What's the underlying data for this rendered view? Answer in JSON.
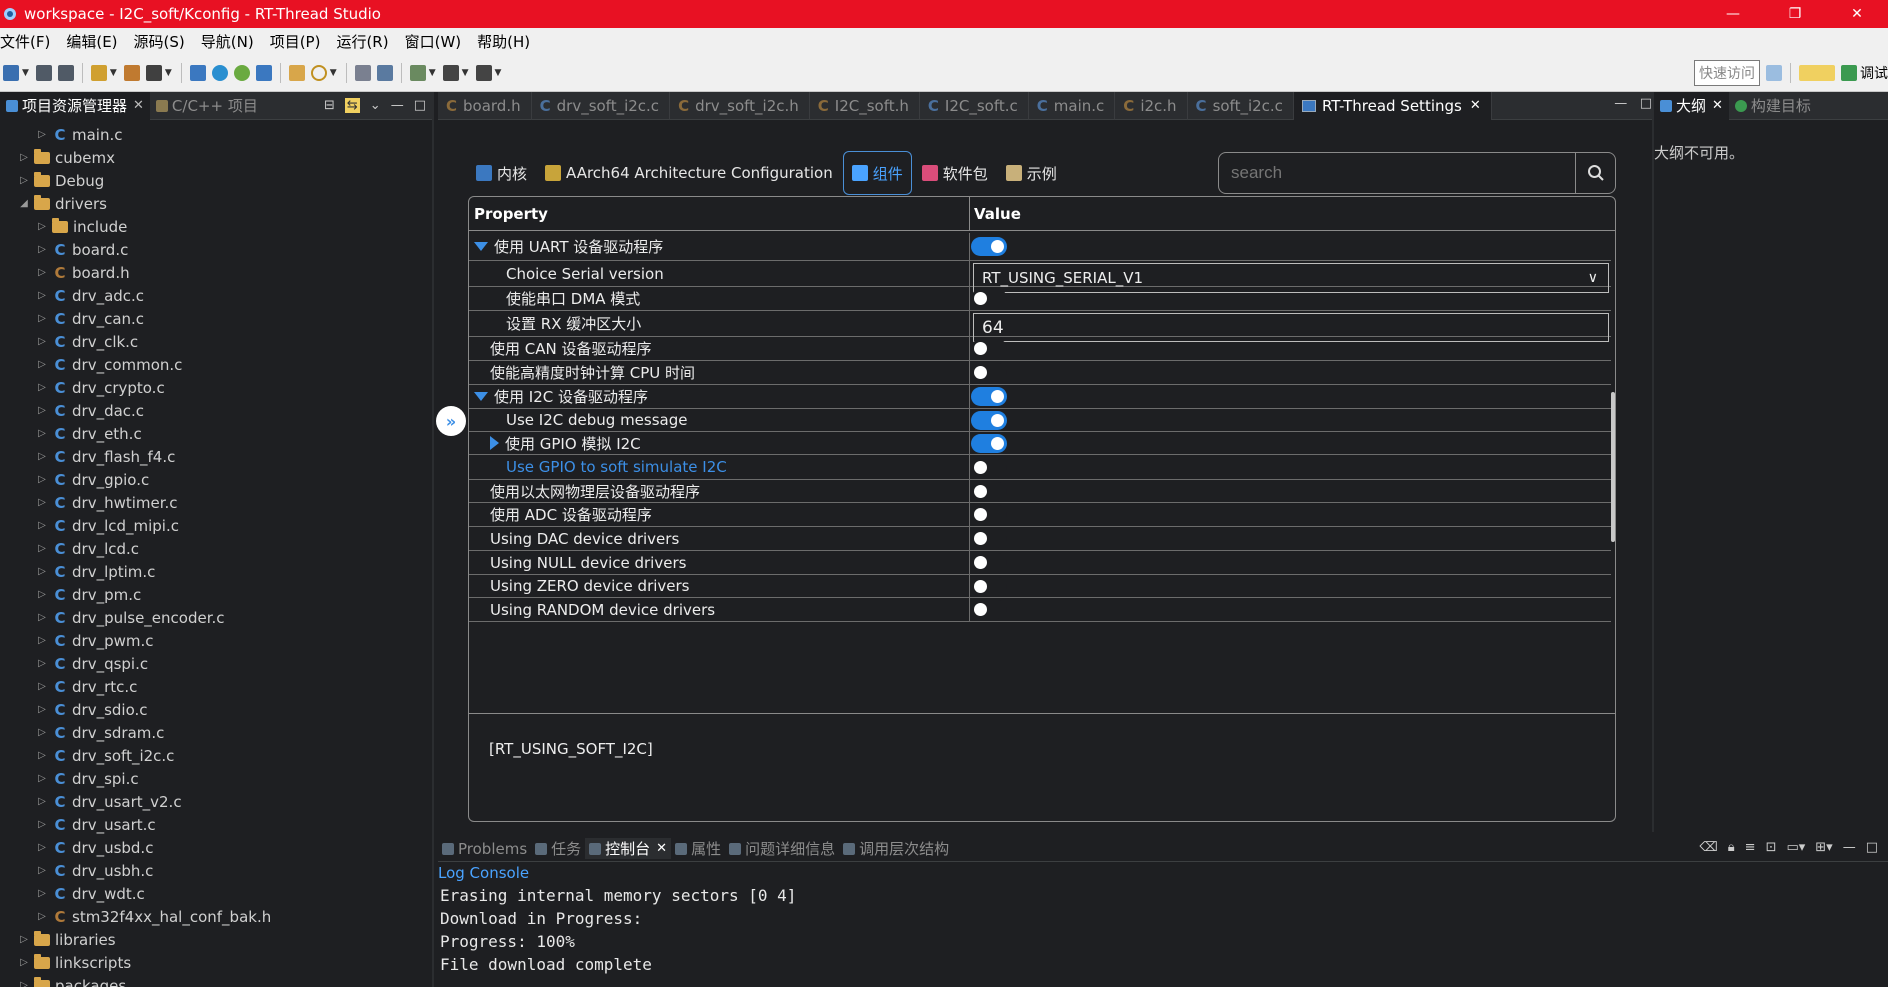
{
  "window": {
    "title": "workspace - I2C_soft/Kconfig - RT-Thread Studio",
    "minimize": "—",
    "restore": "❐",
    "close": "✕"
  },
  "menu": [
    "文件(F)",
    "编辑(E)",
    "源码(S)",
    "导航(N)",
    "项目(P)",
    "运行(R)",
    "窗口(W)",
    "帮助(H)"
  ],
  "toolbar": {
    "quick_access_placeholder": "快速访问",
    "right_label": "调试"
  },
  "explorer": {
    "tabs": [
      {
        "label": "项目资源管理器",
        "active": true
      },
      {
        "label": "C/C++ 项目",
        "active": false
      }
    ],
    "tree": [
      {
        "label": "main.c",
        "kind": "c",
        "indent": 1,
        "twisty": ">"
      },
      {
        "label": "cubemx",
        "kind": "folder",
        "indent": 0,
        "twisty": ">"
      },
      {
        "label": "Debug",
        "kind": "folder",
        "indent": 0,
        "twisty": ">"
      },
      {
        "label": "drivers",
        "kind": "folder",
        "indent": 0,
        "twisty": "v"
      },
      {
        "label": "include",
        "kind": "folder",
        "indent": 1,
        "twisty": ">"
      },
      {
        "label": "board.c",
        "kind": "c",
        "indent": 1,
        "twisty": ">"
      },
      {
        "label": "board.h",
        "kind": "h",
        "indent": 1,
        "twisty": ">"
      },
      {
        "label": "drv_adc.c",
        "kind": "c",
        "indent": 1,
        "twisty": ">"
      },
      {
        "label": "drv_can.c",
        "kind": "c",
        "indent": 1,
        "twisty": ">"
      },
      {
        "label": "drv_clk.c",
        "kind": "c",
        "indent": 1,
        "twisty": ">"
      },
      {
        "label": "drv_common.c",
        "kind": "c",
        "indent": 1,
        "twisty": ">"
      },
      {
        "label": "drv_crypto.c",
        "kind": "c",
        "indent": 1,
        "twisty": ">"
      },
      {
        "label": "drv_dac.c",
        "kind": "c",
        "indent": 1,
        "twisty": ">"
      },
      {
        "label": "drv_eth.c",
        "kind": "c",
        "indent": 1,
        "twisty": ">"
      },
      {
        "label": "drv_flash_f4.c",
        "kind": "c",
        "indent": 1,
        "twisty": ">"
      },
      {
        "label": "drv_gpio.c",
        "kind": "c",
        "indent": 1,
        "twisty": ">"
      },
      {
        "label": "drv_hwtimer.c",
        "kind": "c",
        "indent": 1,
        "twisty": ">"
      },
      {
        "label": "drv_lcd_mipi.c",
        "kind": "c",
        "indent": 1,
        "twisty": ">"
      },
      {
        "label": "drv_lcd.c",
        "kind": "c",
        "indent": 1,
        "twisty": ">"
      },
      {
        "label": "drv_lptim.c",
        "kind": "c",
        "indent": 1,
        "twisty": ">"
      },
      {
        "label": "drv_pm.c",
        "kind": "c",
        "indent": 1,
        "twisty": ">"
      },
      {
        "label": "drv_pulse_encoder.c",
        "kind": "c",
        "indent": 1,
        "twisty": ">"
      },
      {
        "label": "drv_pwm.c",
        "kind": "c",
        "indent": 1,
        "twisty": ">"
      },
      {
        "label": "drv_qspi.c",
        "kind": "c",
        "indent": 1,
        "twisty": ">"
      },
      {
        "label": "drv_rtc.c",
        "kind": "c",
        "indent": 1,
        "twisty": ">"
      },
      {
        "label": "drv_sdio.c",
        "kind": "c",
        "indent": 1,
        "twisty": ">"
      },
      {
        "label": "drv_sdram.c",
        "kind": "c",
        "indent": 1,
        "twisty": ">"
      },
      {
        "label": "drv_soft_i2c.c",
        "kind": "c",
        "indent": 1,
        "twisty": ">"
      },
      {
        "label": "drv_spi.c",
        "kind": "c",
        "indent": 1,
        "twisty": ">"
      },
      {
        "label": "drv_usart_v2.c",
        "kind": "c",
        "indent": 1,
        "twisty": ">"
      },
      {
        "label": "drv_usart.c",
        "kind": "c",
        "indent": 1,
        "twisty": ">"
      },
      {
        "label": "drv_usbd.c",
        "kind": "c",
        "indent": 1,
        "twisty": ">"
      },
      {
        "label": "drv_usbh.c",
        "kind": "c",
        "indent": 1,
        "twisty": ">"
      },
      {
        "label": "drv_wdt.c",
        "kind": "c",
        "indent": 1,
        "twisty": ">"
      },
      {
        "label": "stm32f4xx_hal_conf_bak.h",
        "kind": "h",
        "indent": 1,
        "twisty": ">"
      },
      {
        "label": "libraries",
        "kind": "folder",
        "indent": 0,
        "twisty": ">"
      },
      {
        "label": "linkscripts",
        "kind": "folder",
        "indent": 0,
        "twisty": ">"
      },
      {
        "label": "packages",
        "kind": "folder",
        "indent": 0,
        "twisty": ">"
      }
    ]
  },
  "editor_tabs": [
    {
      "label": "board.h",
      "kind": "h",
      "active": false
    },
    {
      "label": "drv_soft_i2c.c",
      "kind": "c",
      "active": false
    },
    {
      "label": "drv_soft_i2c.h",
      "kind": "h",
      "active": false
    },
    {
      "label": "I2C_soft.h",
      "kind": "h",
      "active": false
    },
    {
      "label": "I2C_soft.c",
      "kind": "c",
      "active": false
    },
    {
      "label": "main.c",
      "kind": "c",
      "active": false
    },
    {
      "label": "i2c.h",
      "kind": "h",
      "active": false
    },
    {
      "label": "soft_i2c.c",
      "kind": "c",
      "active": false
    },
    {
      "label": "RT-Thread Settings",
      "kind": "settings",
      "active": true
    }
  ],
  "settings": {
    "tabs": [
      {
        "label": "内核",
        "active": false,
        "color": "#3b78c0"
      },
      {
        "label": "AArch64 Architecture Configuration",
        "active": false,
        "color": "#c8a43a"
      },
      {
        "label": "组件",
        "active": true,
        "color": "#4aa3ff"
      },
      {
        "label": "软件包",
        "active": false,
        "color": "#d94d7a"
      },
      {
        "label": "示例",
        "active": false,
        "color": "#c8b07a"
      }
    ],
    "search_placeholder": "search",
    "table_headers": {
      "property": "Property",
      "value": "Value"
    },
    "rows": [
      {
        "label": "使用 UART 设备驱动程序",
        "level": 1,
        "expander": "down",
        "control": "toggle",
        "value": true,
        "link": false
      },
      {
        "label": "Choice Serial version",
        "level": 2,
        "expander": "",
        "control": "select",
        "value": "RT_USING_SERIAL_V1",
        "link": false
      },
      {
        "label": "使能串口 DMA 模式",
        "level": 2,
        "expander": "",
        "control": "toggle",
        "value": false,
        "link": false
      },
      {
        "label": "设置 RX 缓冲区大小",
        "level": 2,
        "expander": "",
        "control": "text",
        "value": "64",
        "link": false
      },
      {
        "label": "使用 CAN 设备驱动程序",
        "level": 1,
        "expander": "",
        "control": "toggle",
        "value": false,
        "link": false
      },
      {
        "label": "使能高精度时钟计算 CPU 时间",
        "level": 1,
        "expander": "",
        "control": "toggle",
        "value": false,
        "link": false
      },
      {
        "label": "使用 I2C 设备驱动程序",
        "level": 1,
        "expander": "down",
        "control": "toggle",
        "value": true,
        "link": false
      },
      {
        "label": "Use I2C debug message",
        "level": 2,
        "expander": "",
        "control": "toggle",
        "value": true,
        "link": false
      },
      {
        "label": "使用 GPIO 模拟 I2C",
        "level": 2,
        "expander": "right",
        "control": "toggle",
        "value": true,
        "link": false
      },
      {
        "label": "Use GPIO to soft simulate I2C",
        "level": 2,
        "expander": "",
        "control": "toggle",
        "value": false,
        "link": true
      },
      {
        "label": "使用以太网物理层设备驱动程序",
        "level": 1,
        "expander": "",
        "control": "toggle",
        "value": false,
        "link": false
      },
      {
        "label": "使用 ADC 设备驱动程序",
        "level": 1,
        "expander": "",
        "control": "toggle",
        "value": false,
        "link": false
      },
      {
        "label": "Using DAC device drivers",
        "level": 1,
        "expander": "",
        "control": "toggle",
        "value": false,
        "link": false
      },
      {
        "label": "Using NULL device drivers",
        "level": 1,
        "expander": "",
        "control": "toggle",
        "value": false,
        "link": false
      },
      {
        "label": "Using ZERO device drivers",
        "level": 1,
        "expander": "",
        "control": "toggle",
        "value": false,
        "link": false
      },
      {
        "label": "Using RANDOM device drivers",
        "level": 1,
        "expander": "",
        "control": "toggle",
        "value": false,
        "link": false
      }
    ],
    "description": "[RT_USING_SOFT_I2C]"
  },
  "outline": {
    "tabs": [
      {
        "label": "大纲",
        "active": true
      },
      {
        "label": "构建目标",
        "active": false
      }
    ],
    "message": "大纲不可用。"
  },
  "console": {
    "tabs": [
      {
        "label": "Problems",
        "active": false
      },
      {
        "label": "任务",
        "active": false
      },
      {
        "label": "控制台",
        "active": true
      },
      {
        "label": "属性",
        "active": false
      },
      {
        "label": "问题详细信息",
        "active": false
      },
      {
        "label": "调用层次结构",
        "active": false
      }
    ],
    "log_label": "Log Console",
    "lines": [
      "Erasing internal memory sectors [0 4]",
      "Download in Progress:",
      "Progress: 100%",
      "File download complete"
    ]
  },
  "colors": {
    "titlebar": "#e81123",
    "accent": "#1f7fe0",
    "link": "#3c8fe6",
    "background": "#1e1f22"
  }
}
